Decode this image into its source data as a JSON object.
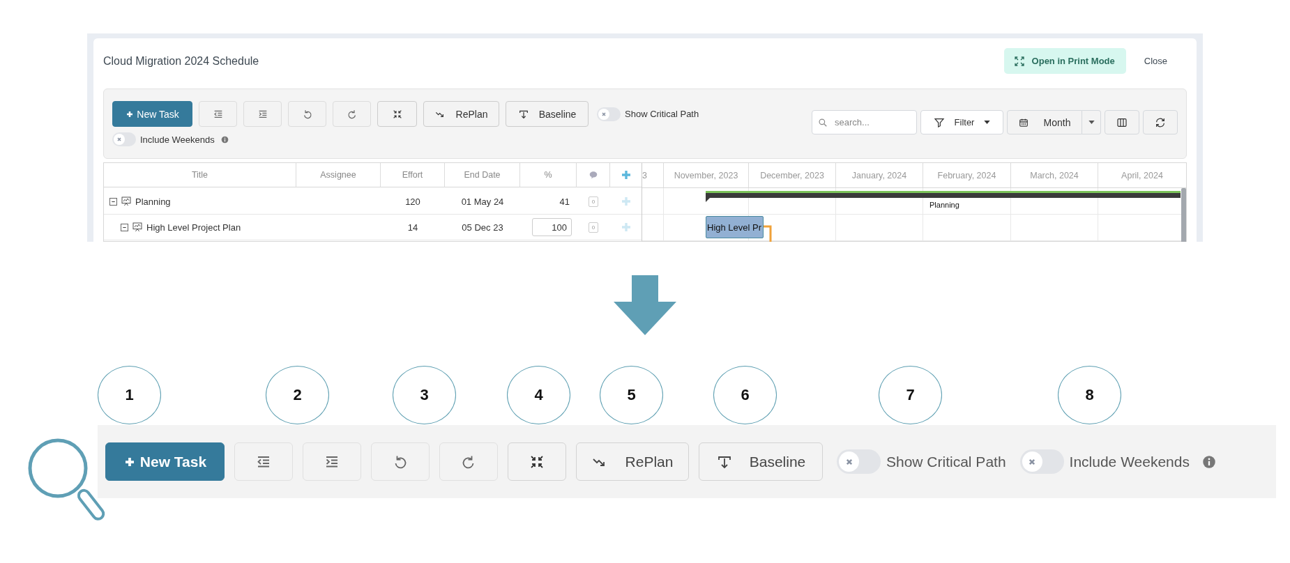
{
  "window": {
    "title": "Cloud Migration 2024 Schedule"
  },
  "header_buttons": [
    {
      "kind": "print",
      "label": "Open in Print Mode"
    },
    {
      "kind": "plain",
      "label": "Close"
    }
  ],
  "toolbar": {
    "buttons": [
      {
        "kind": "new",
        "label": "New Task"
      },
      {
        "kind": "outdent"
      },
      {
        "kind": "indent"
      },
      {
        "kind": "undo"
      },
      {
        "kind": "redo"
      },
      {
        "kind": "collapse"
      },
      {
        "kind": "replan",
        "label": "RePlan"
      },
      {
        "kind": "baseline",
        "label": "Baseline"
      }
    ],
    "toggles": [
      {
        "label": "Show Critical Path",
        "on": false,
        "info": false
      },
      {
        "label": "Include Weekends",
        "on": false,
        "info": true
      }
    ],
    "search": {
      "placeholder": "search..."
    },
    "filter": "Filter",
    "view": "Month"
  },
  "table": {
    "columns": [
      "Title",
      "Assignee",
      "Effort",
      "End Date",
      "%"
    ],
    "rows": [
      {
        "title": "Planning",
        "effort": "120",
        "end_date": "01 May 24",
        "percent": "41",
        "editing": false,
        "comments": "0",
        "expanded": true,
        "children": [
          {
            "title": "High Level Project Plan",
            "effort": "14",
            "end_date": "05 Dec 23",
            "percent": "100",
            "editing": true,
            "comments": "0",
            "expanded": true
          }
        ]
      }
    ]
  },
  "gantt": {
    "months": [
      "3",
      "November, 2023",
      "December, 2023",
      "January, 2024",
      "February, 2024",
      "March, 2024",
      "April, 2024"
    ],
    "bars": [
      {
        "kind": "summary",
        "label": "Planning"
      },
      {
        "kind": "task",
        "label": "High Level Pr"
      }
    ]
  },
  "zoom_view": {
    "callouts": [
      "1",
      "2",
      "3",
      "4",
      "5",
      "6",
      "7",
      "8"
    ],
    "buttons": [
      {
        "kind": "new",
        "label": "New Task"
      },
      {
        "kind": "outdent"
      },
      {
        "kind": "indent"
      },
      {
        "kind": "undo"
      },
      {
        "kind": "redo"
      },
      {
        "kind": "collapse"
      },
      {
        "kind": "replan",
        "label": "RePlan"
      },
      {
        "kind": "baseline",
        "label": "Baseline"
      }
    ],
    "toggles": [
      {
        "label": "Show Critical Path",
        "on": false,
        "info": false
      },
      {
        "label": "Include Weekends",
        "on": false,
        "info": true
      }
    ]
  }
}
